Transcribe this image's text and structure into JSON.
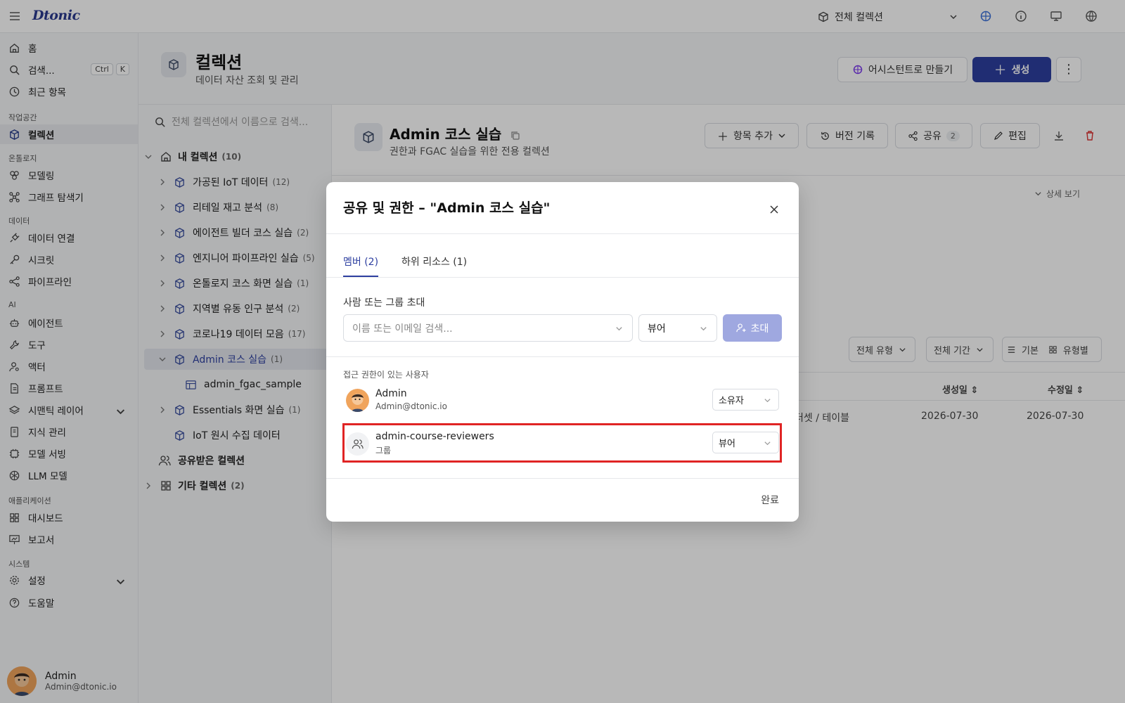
{
  "topbar": {
    "logo": "Dtonic",
    "scope_label": "전체 컬렉션"
  },
  "sidebar": {
    "home": "홈",
    "search": "검색...",
    "search_kbd1": "Ctrl",
    "search_kbd2": "K",
    "recent": "최근 항목",
    "sec_workspace": "작업공간",
    "collections": "컬렉션",
    "sec_ontology": "온톨로지",
    "modeling": "모델링",
    "graph": "그래프 탐색기",
    "sec_data": "데이터",
    "data_conn": "데이터 연결",
    "secrets": "시크릿",
    "pipeline": "파이프라인",
    "sec_ai": "AI",
    "agent": "에이전트",
    "tool": "도구",
    "actor": "액터",
    "prompt": "프롬프트",
    "semantic": "시맨틱 레이어",
    "knowledge": "지식 관리",
    "serving": "모델 서빙",
    "llm": "LLM 모델",
    "sec_app": "애플리케이션",
    "dashboard": "대시보드",
    "report": "보고서",
    "sec_system": "시스템",
    "settings": "설정",
    "help": "도움말",
    "user_name": "Admin",
    "user_email": "Admin@dtonic.io"
  },
  "header": {
    "title": "컬렉션",
    "subtitle": "데이터 자산 조회 및 관리",
    "assistant_btn": "어시스턴트로 만들기",
    "create_btn": "생성"
  },
  "tree": {
    "search_placeholder": "전체 컬렉션에서 이름으로 검색...",
    "my_collections": "내 컬렉션",
    "my_count": "(10)",
    "items": [
      {
        "label": "가공된 IoT 데이터",
        "count": "(12)"
      },
      {
        "label": "리테일 재고 분석",
        "count": "(8)"
      },
      {
        "label": "에이전트 빌더 코스 실습",
        "count": "(2)"
      },
      {
        "label": "엔지니어 파이프라인 실습",
        "count": "(5)"
      },
      {
        "label": "온톨로지 코스 화면 실습",
        "count": "(1)"
      },
      {
        "label": "지역별 유동 인구 분석",
        "count": "(2)"
      },
      {
        "label": "코로나19 데이터 모음",
        "count": "(17)"
      },
      {
        "label": "Admin 코스 실습",
        "count": "(1)"
      }
    ],
    "child": "admin_fgac_sample",
    "after_items": [
      {
        "label": "Essentials 화면 실습",
        "count": "(1)"
      },
      {
        "label": "IoT 원시 수집 데이터",
        "count": ""
      }
    ],
    "shared": "공유받은 컬렉션",
    "other": "기타 컬렉션",
    "other_count": "(2)"
  },
  "main": {
    "title": "Admin 코스 실습",
    "subtitle": "권한과 FGAC 실습을 위한 전용 컬렉션",
    "add_item": "항목 추가",
    "version": "버전 기록",
    "share": "공유",
    "share_count": "2",
    "edit": "편집",
    "detail": "상세 보기",
    "filter_type": "전체 유형",
    "filter_period": "전체 기간",
    "view_basic": "기본",
    "view_type": "유형별",
    "col_created": "생성일",
    "col_modified": "수정일",
    "row_type": "터셋 / 테이블",
    "row_created": "2026-07-30",
    "row_modified": "2026-07-30"
  },
  "modal": {
    "title": "공유 및 권한 – \"Admin 코스 실습\"",
    "tab_members": "멤버 (2)",
    "tab_sub": "하위 리소스 (1)",
    "invite_label": "사람 또는 그룹 초대",
    "invite_placeholder": "이름 또는 이메일 검색...",
    "invite_role": "뷰어",
    "invite_btn": "초대",
    "access_label": "접근 권한이 있는 사용자",
    "members": [
      {
        "name": "Admin",
        "sub": "Admin@dtonic.io",
        "role": "소유자"
      },
      {
        "name": "admin-course-reviewers",
        "sub": "그룹",
        "role": "뷰어"
      }
    ],
    "done": "완료"
  }
}
